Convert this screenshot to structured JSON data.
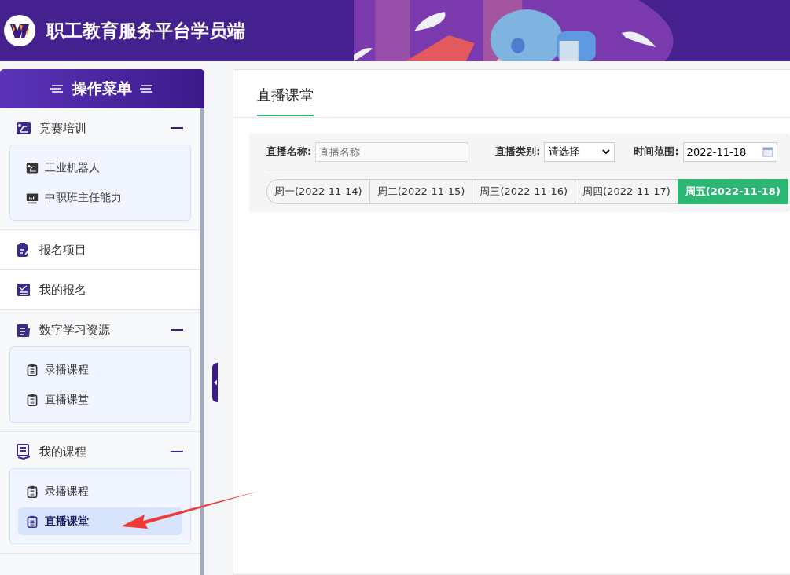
{
  "header": {
    "title": "职工教育服务平台学员端"
  },
  "sidebar": {
    "title": "操作菜单",
    "items": [
      {
        "kind": "group",
        "label": "竞赛培训",
        "expanded": true,
        "children": [
          {
            "label": "工业机器人",
            "selected": false
          },
          {
            "label": "中职班主任能力",
            "selected": false
          }
        ]
      },
      {
        "kind": "link",
        "label": "报名项目"
      },
      {
        "kind": "link",
        "label": "我的报名"
      },
      {
        "kind": "group",
        "label": "数字学习资源",
        "expanded": true,
        "children": [
          {
            "label": "录播课程",
            "selected": false
          },
          {
            "label": "直播课堂",
            "selected": false
          }
        ]
      },
      {
        "kind": "group",
        "label": "我的课程",
        "expanded": true,
        "children": [
          {
            "label": "录播课程",
            "selected": false
          },
          {
            "label": "直播课堂",
            "selected": true
          }
        ]
      }
    ]
  },
  "page": {
    "title": "直播课堂",
    "filters": {
      "name_label": "直播名称:",
      "name_placeholder": "直播名称",
      "type_label": "直播类别:",
      "type_value": "请选择",
      "time_label": "时间范围:",
      "time_value": "2022-11-18"
    },
    "days": [
      {
        "label": "周一(2022-11-14)",
        "selected": false
      },
      {
        "label": "周二(2022-11-15)",
        "selected": false
      },
      {
        "label": "周三(2022-11-16)",
        "selected": false
      },
      {
        "label": "周四(2022-11-17)",
        "selected": false
      },
      {
        "label": "周五(2022-11-18)",
        "selected": true
      }
    ]
  }
}
